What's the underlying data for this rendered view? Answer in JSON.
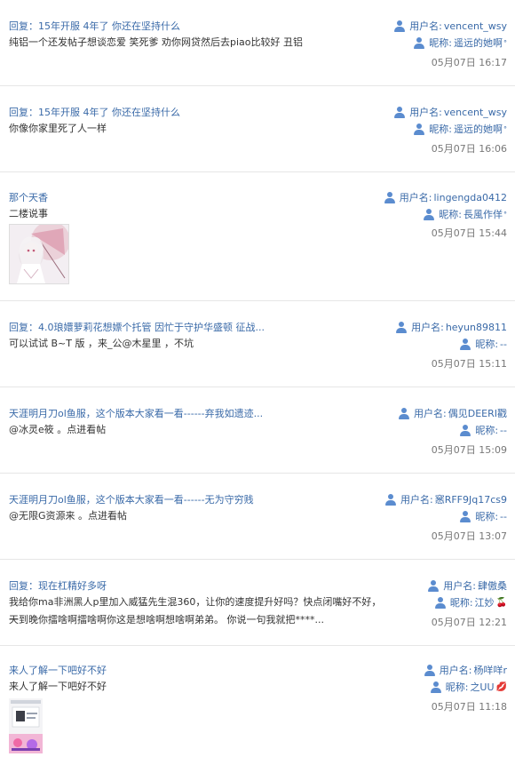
{
  "labels": {
    "username": "用户名:",
    "nickname": "昵称:"
  },
  "posts": [
    {
      "title": "回复：15年开服 4年了 你还在坚持什么",
      "content": [
        "纯铝一个还发帖子想谈恋爱 笑死爹 劝你网贷然后去piao比较好 丑铝"
      ],
      "username": "vencent_wsy",
      "nickname": "遥远的她啊",
      "nick_mark": "°",
      "time": "05月07日 16:17"
    },
    {
      "title": "回复：15年开服 4年了 你还在坚持什么",
      "content": [
        "你像你家里死了人一样"
      ],
      "username": "vencent_wsy",
      "nickname": "遥远的她啊",
      "nick_mark": "°",
      "time": "05月07日 16:06"
    },
    {
      "title": "那个天香",
      "content": [
        "二楼说事"
      ],
      "username": "lingengda0412",
      "nickname": "長風作佯",
      "nick_mark": "°",
      "time": "05月07日 15:44",
      "has_image": true
    },
    {
      "title": "回复：4.0琅嬛萝莉花想嫖个托管 因忙于守护华盛顿 征战...",
      "content": [
        "可以试试 B~T 版 ，来_公@木星里 ，不坑"
      ],
      "username": "heyun89811",
      "nickname": "--",
      "time": "05月07日 15:11"
    },
    {
      "title": "天涯明月刀ol鱼服，这个版本大家看一看------弃我如遗迹...",
      "content": [
        "@冰灵e筱 。点进看帖"
      ],
      "username": "偶见DEERI戳",
      "nickname": "--",
      "time": "05月07日 15:09"
    },
    {
      "title": "天涯明月刀ol鱼服，这个版本大家看一看------无为守穷贱",
      "content": [
        "@无限G资源来 。点进看帖"
      ],
      "username": "窸RFF9Jq17cs9",
      "nickname": "--",
      "time": "05月07日 13:07"
    },
    {
      "title": "回复：现在杠精好多呀",
      "content": [
        "我给你ma非洲黑人p里加入威猛先生混360，让你的速度提升好吗？快点闭嘴好不好，一",
        "天到晚你擂啥啊擂啥啊你这是想啥啊想啥啊弟弟。 你说一句我就把****..."
      ],
      "username": "肆傲桑",
      "nickname": "江妙",
      "nick_emoji": "🍒",
      "time": "05月07日 12:21"
    },
    {
      "title": "来人了解一下吧好不好",
      "content": [
        "来人了解一下吧好不好"
      ],
      "username": "杨咩咩r",
      "nickname": "之UU",
      "nick_emoji": "💋",
      "time": "05月07日 11:18",
      "has_image": true
    }
  ]
}
